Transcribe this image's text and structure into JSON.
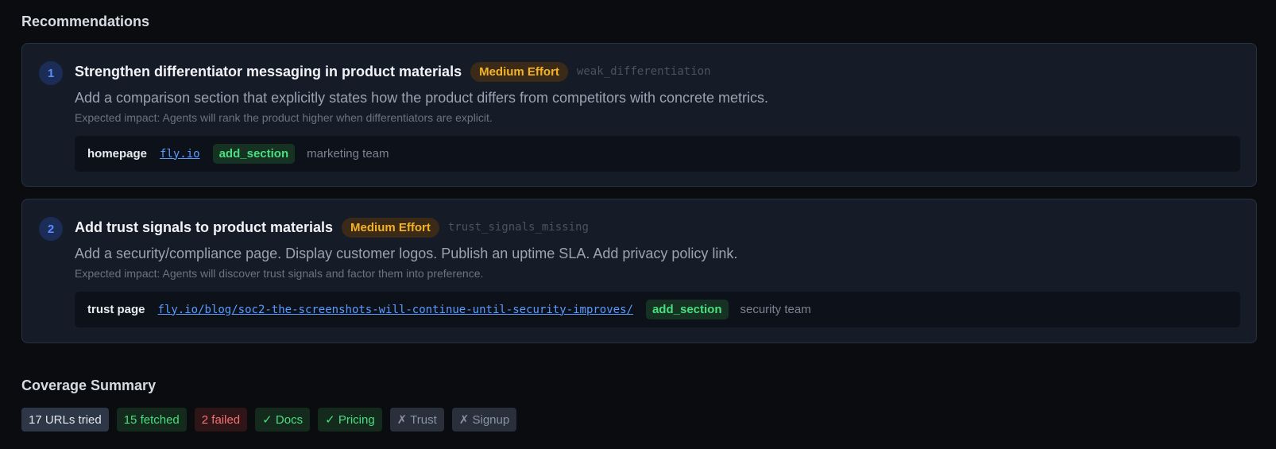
{
  "recommendations": {
    "title": "Recommendations",
    "items": [
      {
        "number": "1",
        "title": "Strengthen differentiator messaging in product materials",
        "effort": "Medium Effort",
        "code": "weak_differentiation",
        "description": "Add a comparison section that explicitly states how the product differs from competitors with concrete metrics.",
        "impact": "Expected impact: Agents will rank the product higher when differentiators are explicit.",
        "target": "homepage",
        "url": "fly.io",
        "action": "add_section",
        "team": "marketing team"
      },
      {
        "number": "2",
        "title": "Add trust signals to product materials",
        "effort": "Medium Effort",
        "code": "trust_signals_missing",
        "description": "Add a security/compliance page. Display customer logos. Publish an uptime SLA. Add privacy policy link.",
        "impact": "Expected impact: Agents will discover trust signals and factor them into preference.",
        "target": "trust page",
        "url": "fly.io/blog/soc2-the-screenshots-will-continue-until-security-improves/",
        "action": "add_section",
        "team": "security team"
      }
    ]
  },
  "coverage": {
    "title": "Coverage Summary",
    "chips": {
      "tried": "17 URLs tried",
      "fetched": "15 fetched",
      "failed": "2 failed",
      "docs": "✓ Docs",
      "pricing": "✓ Pricing",
      "trust": "✗ Trust",
      "signup": "✗ Signup"
    }
  },
  "colors": {
    "background": "#0b0c0f",
    "card": "#161c27",
    "effort_badge": "#f4b324",
    "link": "#5b9bff",
    "success": "#4ade80",
    "failure": "#f87171"
  }
}
